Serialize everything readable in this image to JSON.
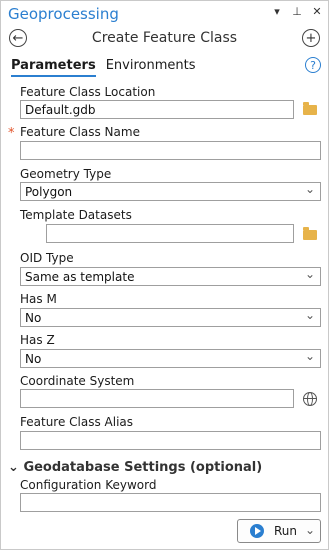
{
  "pane": {
    "title": "Geoprocessing",
    "controls": {
      "menu": "▾",
      "pin": "⊥",
      "close": "✕"
    }
  },
  "toolbar": {
    "back_icon": "←",
    "add_icon": "+",
    "tool_title": "Create Feature Class"
  },
  "tabs": [
    {
      "label": "Parameters",
      "active": true
    },
    {
      "label": "Environments",
      "active": false
    }
  ],
  "help_icon": "?",
  "params": {
    "location_label": "Feature Class Location",
    "location_value": "Default.gdb",
    "name_label": "Feature Class Name",
    "name_required_marker": "*",
    "name_value": "",
    "geometry_label": "Geometry Type",
    "geometry_value": "Polygon",
    "template_label": "Template Datasets",
    "template_value": "",
    "oid_label": "OID Type",
    "oid_value": "Same as template",
    "hasm_label": "Has M",
    "hasm_value": "No",
    "hasz_label": "Has Z",
    "hasz_value": "No",
    "coord_label": "Coordinate System",
    "coord_value": "",
    "alias_label": "Feature Class Alias",
    "alias_value": ""
  },
  "gdb_section": {
    "chevron": "⌄",
    "title": "Geodatabase Settings (optional)",
    "config_label": "Configuration Keyword",
    "config_value": ""
  },
  "run": {
    "label": "Run",
    "caret": "⌄"
  },
  "colors": {
    "accent": "#2b7fd0",
    "required": "#e2542b",
    "folder": "#e7b34a"
  }
}
